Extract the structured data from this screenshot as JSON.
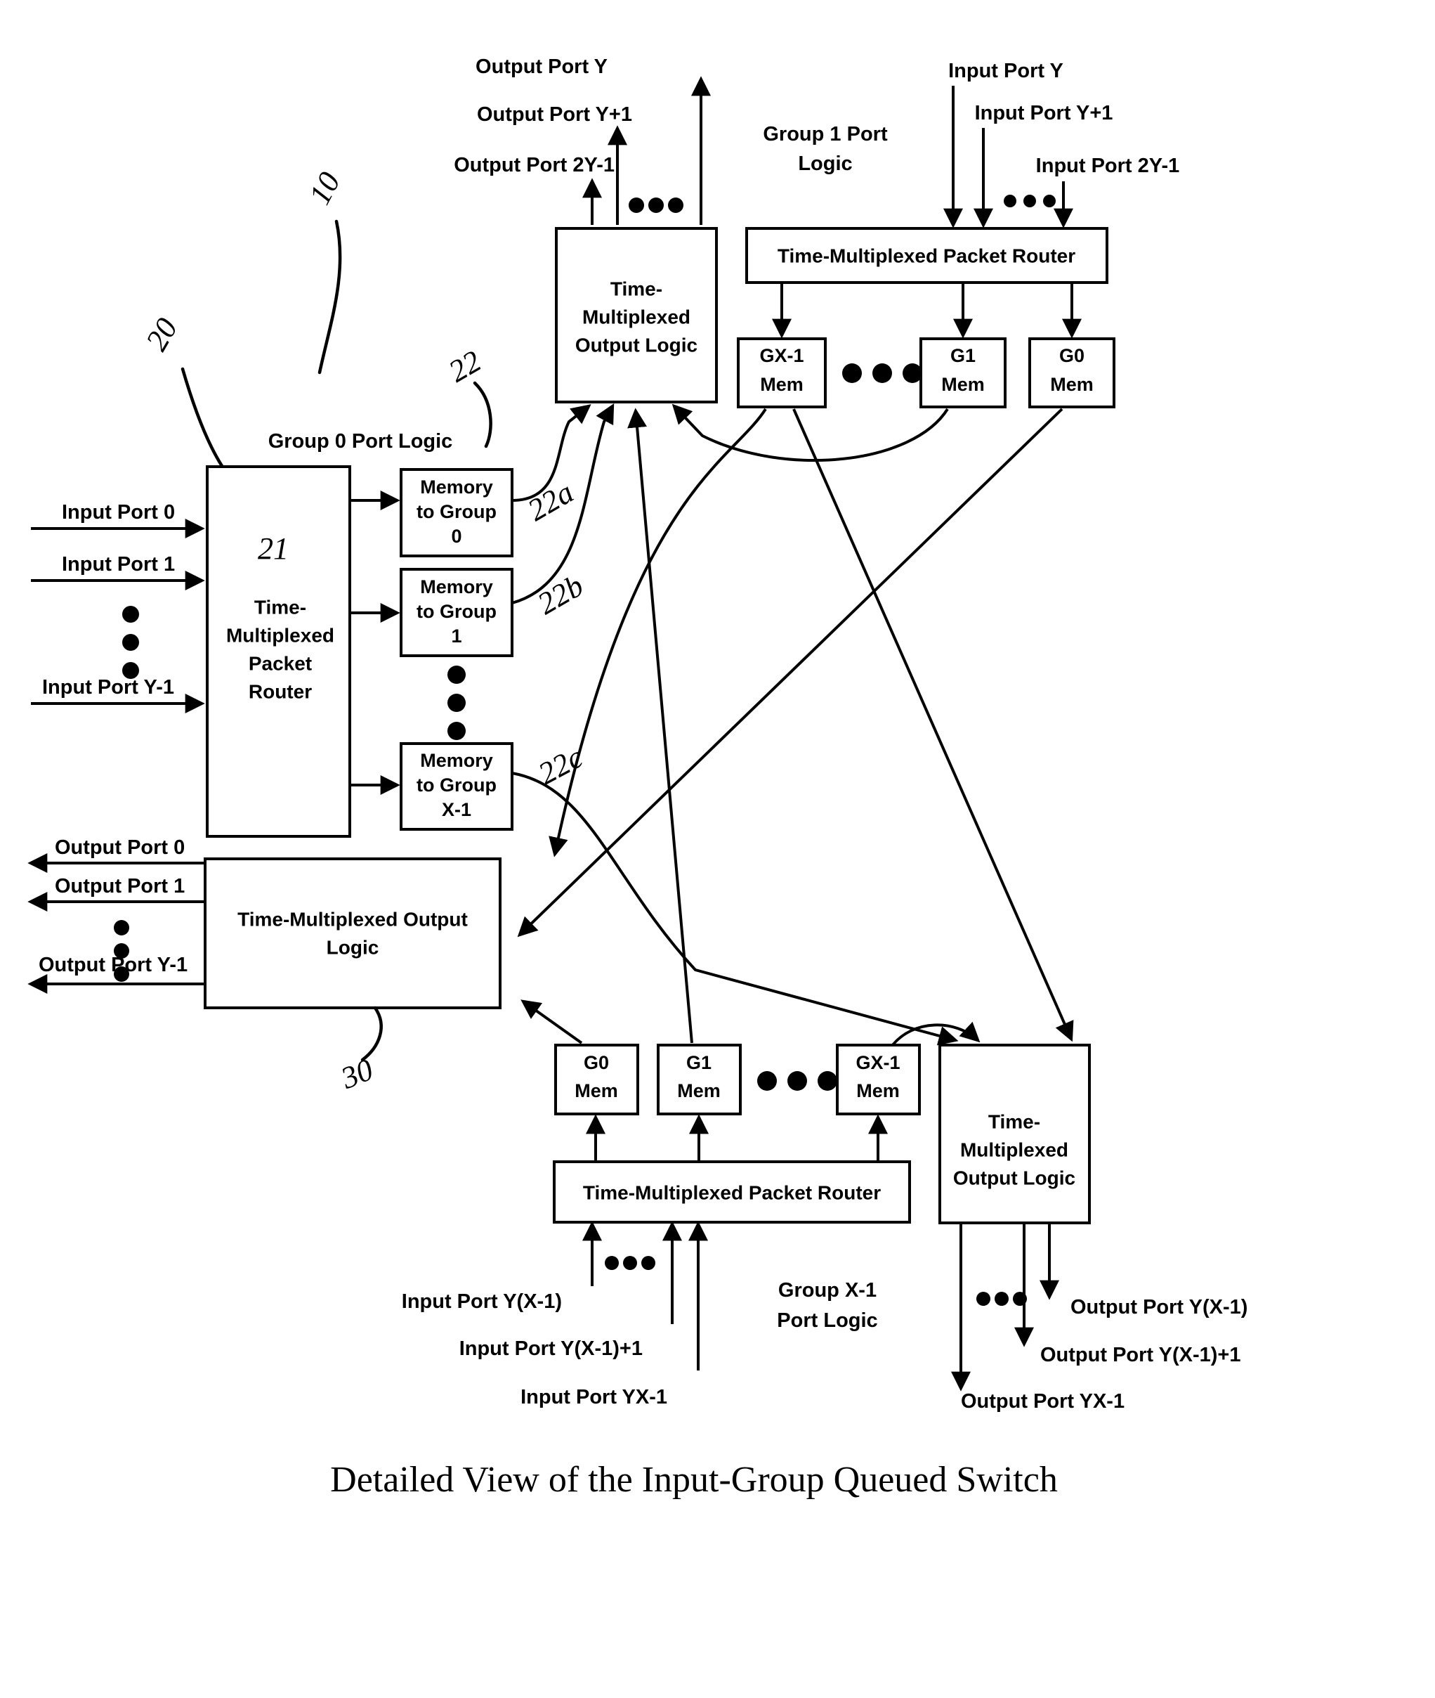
{
  "figure": {
    "caption": "Detailed View of the Input-Group Queued Switch"
  },
  "reference_numerals": {
    "switch": "10",
    "group0_port_logic": "20",
    "packet_router": "21",
    "memory_bank": "22",
    "memory_to_group_0": "22a",
    "memory_to_group_1": "22b",
    "memory_to_group_x1": "22c",
    "output_logic": "30"
  },
  "group0": {
    "title": "Group 0 Port Logic",
    "router_label": "Time-\nMultiplexed\nPacket\nRouter",
    "router_lines": [
      "Time-",
      "Multiplexed",
      "Packet",
      "Router"
    ],
    "inputs": [
      "Input Port 0",
      "Input Port 1",
      "Input Port Y-1"
    ],
    "memories": [
      {
        "lines": [
          "Memory",
          "to Group",
          "0"
        ]
      },
      {
        "lines": [
          "Memory",
          "to Group",
          "1"
        ]
      },
      {
        "lines": [
          "Memory",
          "to Group",
          "X-1"
        ]
      }
    ]
  },
  "group0_output": {
    "label_lines": [
      "Time-Multiplexed Output",
      "Logic"
    ],
    "outputs": [
      "Output Port 0",
      "Output Port 1",
      "Output Port Y-1"
    ]
  },
  "group1": {
    "title_lines": [
      "Group 1 Port",
      "Logic"
    ],
    "router_label": "Time-Multiplexed Packet Router",
    "inputs": [
      "Input Port Y",
      "Input Port Y+1",
      "Input Port 2Y-1"
    ],
    "memories": [
      {
        "lines": [
          "GX-1",
          "Mem"
        ]
      },
      {
        "lines": [
          "G1",
          "Mem"
        ]
      },
      {
        "lines": [
          "G0",
          "Mem"
        ]
      }
    ]
  },
  "group1_output": {
    "label_lines": [
      "Time-",
      "Multiplexed",
      "Output Logic"
    ],
    "outputs": [
      "Output Port Y",
      "Output Port Y+1",
      "Output Port 2Y-1"
    ]
  },
  "groupX1": {
    "title_lines": [
      "Group X-1",
      "Port Logic"
    ],
    "router_label": "Time-Multiplexed Packet Router",
    "inputs": [
      "Input Port Y(X-1)",
      "Input Port Y(X-1)+1",
      "Input Port YX-1"
    ],
    "memories": [
      {
        "lines": [
          "G0",
          "Mem"
        ]
      },
      {
        "lines": [
          "G1",
          "Mem"
        ]
      },
      {
        "lines": [
          "GX-1",
          "Mem"
        ]
      }
    ]
  },
  "groupX1_output": {
    "label_lines": [
      "Time-",
      "Multiplexed",
      "Output Logic"
    ],
    "outputs": [
      "Output Port Y(X-1)",
      "Output Port Y(X-1)+1",
      "Output Port YX-1"
    ]
  },
  "colors": {
    "stroke": "#000000",
    "fill": "#ffffff"
  }
}
